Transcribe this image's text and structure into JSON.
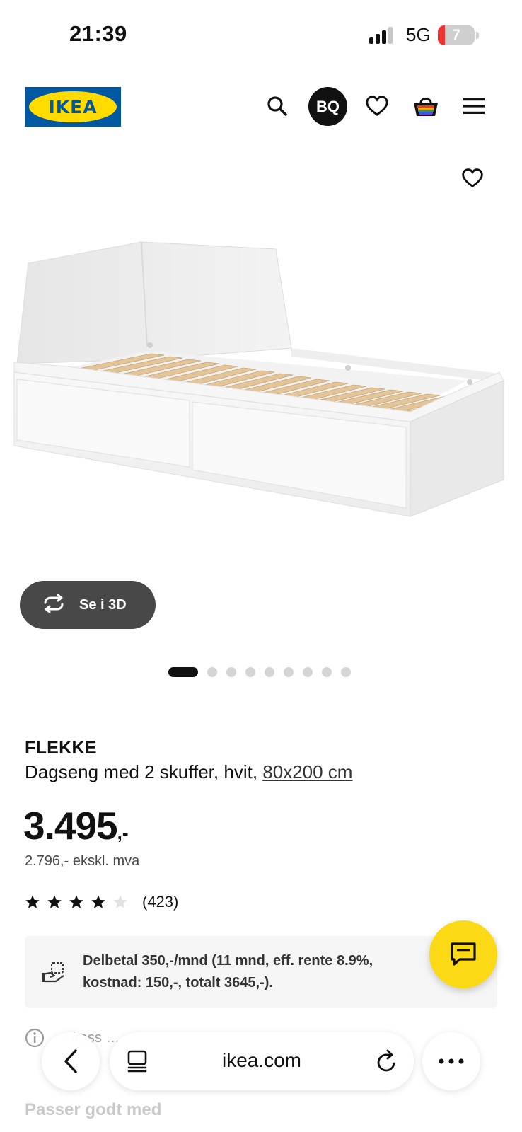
{
  "status_bar": {
    "time": "21:39",
    "network": "5G",
    "battery": "7"
  },
  "header": {
    "logo_text": "IKEA",
    "avatar_initials": "BQ",
    "icons": [
      "search-icon",
      "heart-icon",
      "cart-icon",
      "menu-icon"
    ]
  },
  "gallery": {
    "view_3d_label": "Se i 3D",
    "slides_total": 9,
    "slide_active": 1
  },
  "product": {
    "name": "FLEKKE",
    "description": "Dagseng med 2 skuffer, hvit,",
    "size_link": "80x200 cm",
    "price_main": "3.495",
    "price_suffix": ",-",
    "price_ex_vat": "2.796,- ekskl. mva",
    "rating_stars": 4,
    "rating_max": 5,
    "review_count": "(423)"
  },
  "finance": {
    "text": "Delbetal 350,-/mnd (11 mnd, eff. rente 8.9%, kostnad: 150,-, totalt 3645,-)."
  },
  "info_partial": "… /rass …",
  "section_heading": "Passer godt med",
  "browser": {
    "url": "ikea.com"
  },
  "colors": {
    "ikea_blue": "#0058a3",
    "ikea_yellow": "#ffdb00",
    "chat_yellow": "#fbd914"
  }
}
